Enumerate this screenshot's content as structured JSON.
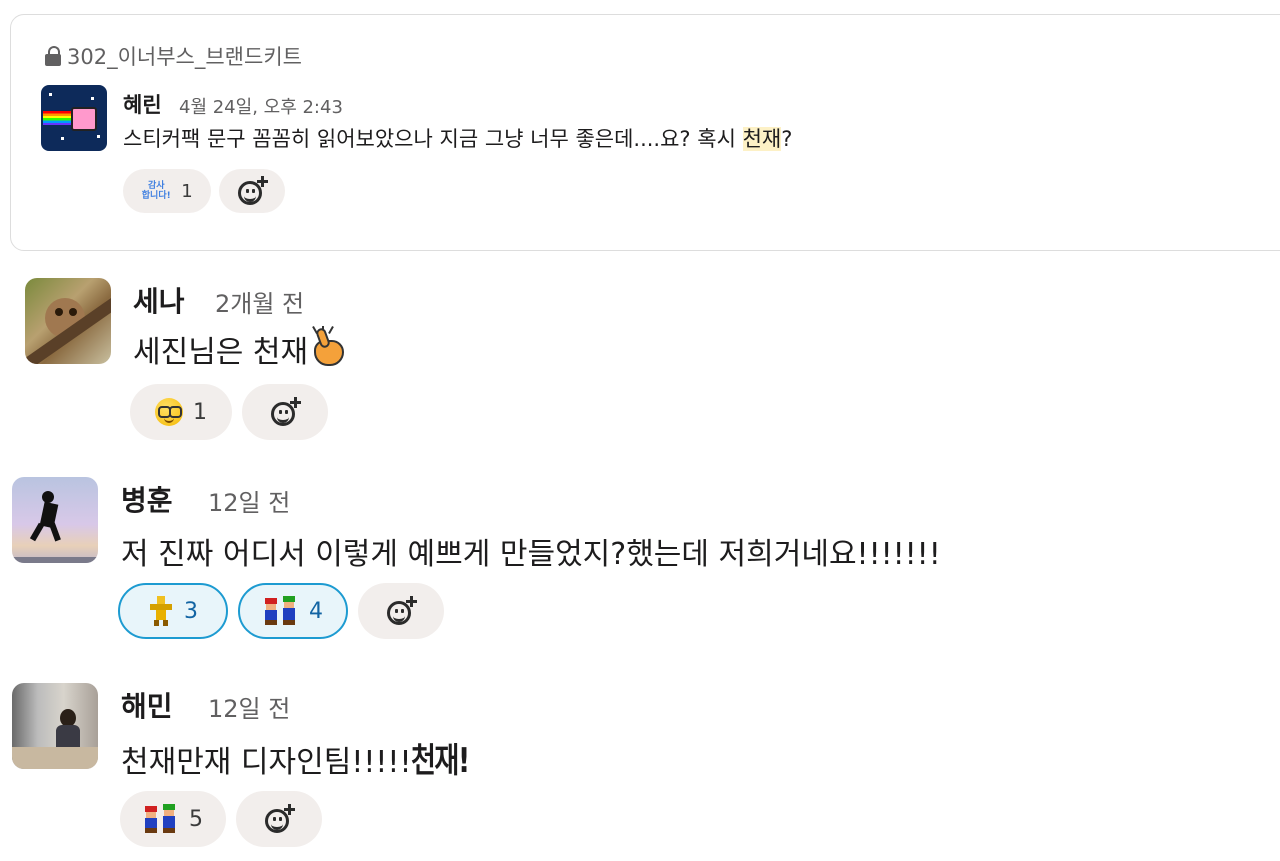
{
  "quote": {
    "channel": "302_이너부스_브랜드키트",
    "author": "혜린",
    "timestamp": "4월 24일, 오후 2:43",
    "text_before": "스티커팩 문구 꼼꼼히 읽어보았으나 지금 그냥 너무 좋은데....요? 혹시 ",
    "text_highlight": "천재",
    "text_after": "?",
    "reactions": [
      {
        "icon": "thanks-emoji",
        "icon_text_1": "감사",
        "icon_text_2": "합니다!",
        "count": "1"
      }
    ]
  },
  "comments": [
    {
      "author": "세나",
      "time": "2개월 전",
      "text": "세진님은 천재",
      "trailing_icon": "hand-sparkle-icon",
      "reactions": [
        {
          "icon": "nerd-face-emoji",
          "count": "1"
        }
      ]
    },
    {
      "author": "병훈",
      "time": "12일 전",
      "text": "저 진짜 어디서 이렇게 예쁘게 만들었지?했는데 저희거네요!!!!!!!",
      "reactions": [
        {
          "icon": "pixel-hero-emoji",
          "count": "3",
          "active": true
        },
        {
          "icon": "pixel-mario-luigi-emoji",
          "count": "4",
          "active": true
        }
      ]
    },
    {
      "author": "해민",
      "time": "12일 전",
      "text": "천재만재 디자인팀!!!!!",
      "sticker_text": "천재!",
      "reactions": [
        {
          "icon": "pixel-mario-luigi-emoji",
          "count": "5"
        }
      ]
    }
  ],
  "colors": {
    "highlight": "#fdf1c6",
    "active_reaction_border": "#1d9bd1",
    "active_reaction_bg": "#e8f5fa",
    "pill_bg": "#f2eeec"
  }
}
